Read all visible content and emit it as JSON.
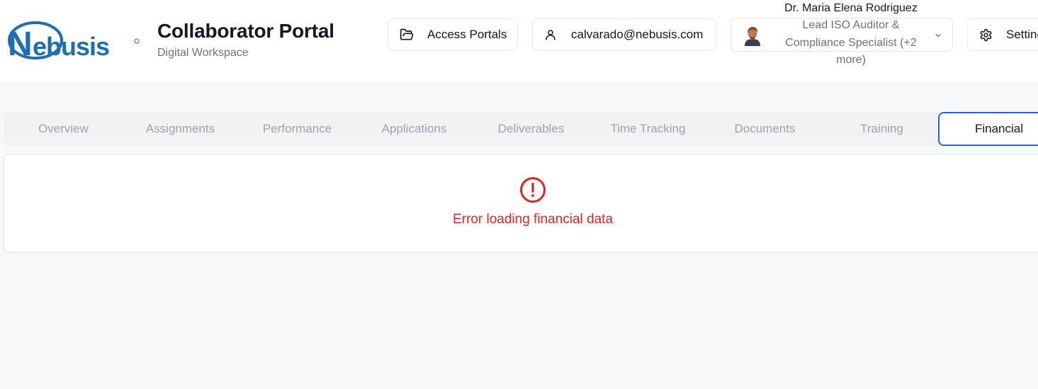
{
  "brand": {
    "logo_text": "Nebusis",
    "title": "Collaborator Portal",
    "subtitle": "Digital Workspace"
  },
  "header": {
    "access_portals": {
      "label": "Access Portals",
      "icon": "folder-open-icon"
    },
    "account": {
      "email": "calvarado@nebusis.com",
      "icon": "user-icon"
    },
    "profile": {
      "name": "Dr. Maria Elena Rodriguez",
      "role": "Lead ISO Auditor & Compliance Specialist (+2 more)",
      "avatar": "avatar",
      "dropdown_icon": "chevron-down-icon"
    },
    "settings": {
      "label": "Settings",
      "icon": "gear-icon"
    }
  },
  "tabs": [
    {
      "label": "Overview"
    },
    {
      "label": "Assignments"
    },
    {
      "label": "Performance"
    },
    {
      "label": "Applications"
    },
    {
      "label": "Deliverables"
    },
    {
      "label": "Time Tracking"
    },
    {
      "label": "Documents"
    },
    {
      "label": "Training"
    },
    {
      "label": "Financial"
    }
  ],
  "active_tab": "Financial",
  "content": {
    "error_message": "Error loading financial data",
    "error_icon": "alert-circle-icon"
  },
  "colors": {
    "brand_blue": "#1d6fb0",
    "accent": "#2563eb",
    "error": "#dc2626",
    "muted_text": "#6b7280",
    "tab_inactive": "#9ca3af",
    "background": "#f7f8fa"
  }
}
